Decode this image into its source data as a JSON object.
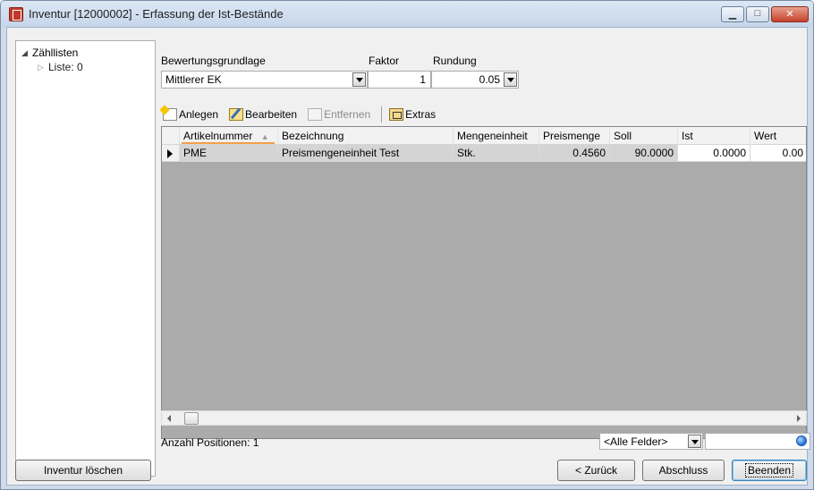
{
  "window": {
    "title": "Inventur [12000002] - Erfassung der Ist-Bestände",
    "controls": {
      "minimize": "▁",
      "maximize": "□",
      "close": "✕"
    }
  },
  "tree": {
    "root": "Zähllisten",
    "child": "Liste: 0"
  },
  "settings": {
    "basis_label": "Bewertungsgrundlage",
    "basis_value": "Mittlerer EK",
    "factor_label": "Faktor",
    "factor_value": "1",
    "rounding_label": "Rundung",
    "rounding_value": "0.05"
  },
  "toolbar": {
    "add": "Anlegen",
    "edit": "Bearbeiten",
    "remove": "Entfernen",
    "extras": "Extras"
  },
  "table": {
    "columns": [
      "Artikelnummer",
      "Bezeichnung",
      "Mengeneinheit",
      "Preismenge",
      "Soll",
      "Ist",
      "Wert"
    ],
    "rows": [
      [
        "PME",
        "Preismengeneinheit Test",
        "Stk.",
        "0.4560",
        "90.0000",
        "0.0000",
        "0.00"
      ]
    ]
  },
  "status": {
    "count_text": "Anzahl Positionen: 1",
    "field_filter": "<Alle Felder>",
    "search_value": ""
  },
  "buttons": {
    "delete_inventory": "Inventur löschen",
    "back": "< Zurück",
    "finish": "Abschluss",
    "close": "Beenden"
  }
}
